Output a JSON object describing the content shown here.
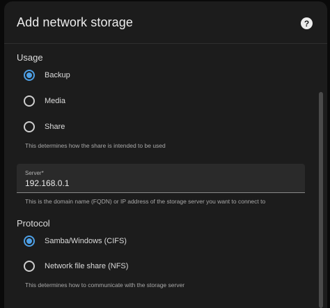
{
  "dialog": {
    "title": "Add network storage",
    "help_icon": "question-circle-icon",
    "help_glyph": "?"
  },
  "usage": {
    "label": "Usage",
    "options": [
      {
        "label": "Backup",
        "checked": true
      },
      {
        "label": "Media",
        "checked": false
      },
      {
        "label": "Share",
        "checked": false
      }
    ],
    "helper": "This determines how the share is intended to be used"
  },
  "server": {
    "label": "Server*",
    "value": "192.168.0.1",
    "helper": "This is the domain name (FQDN) or IP address of the storage server you want to connect to"
  },
  "protocol": {
    "label": "Protocol",
    "options": [
      {
        "label": "Samba/Windows (CIFS)",
        "checked": true
      },
      {
        "label": "Network file share (NFS)",
        "checked": false
      }
    ],
    "helper": "This determines how to communicate with the storage server"
  },
  "colors": {
    "accent": "#4ea0e6",
    "surface": "#1c1c1c",
    "field": "#2a2a2a"
  }
}
